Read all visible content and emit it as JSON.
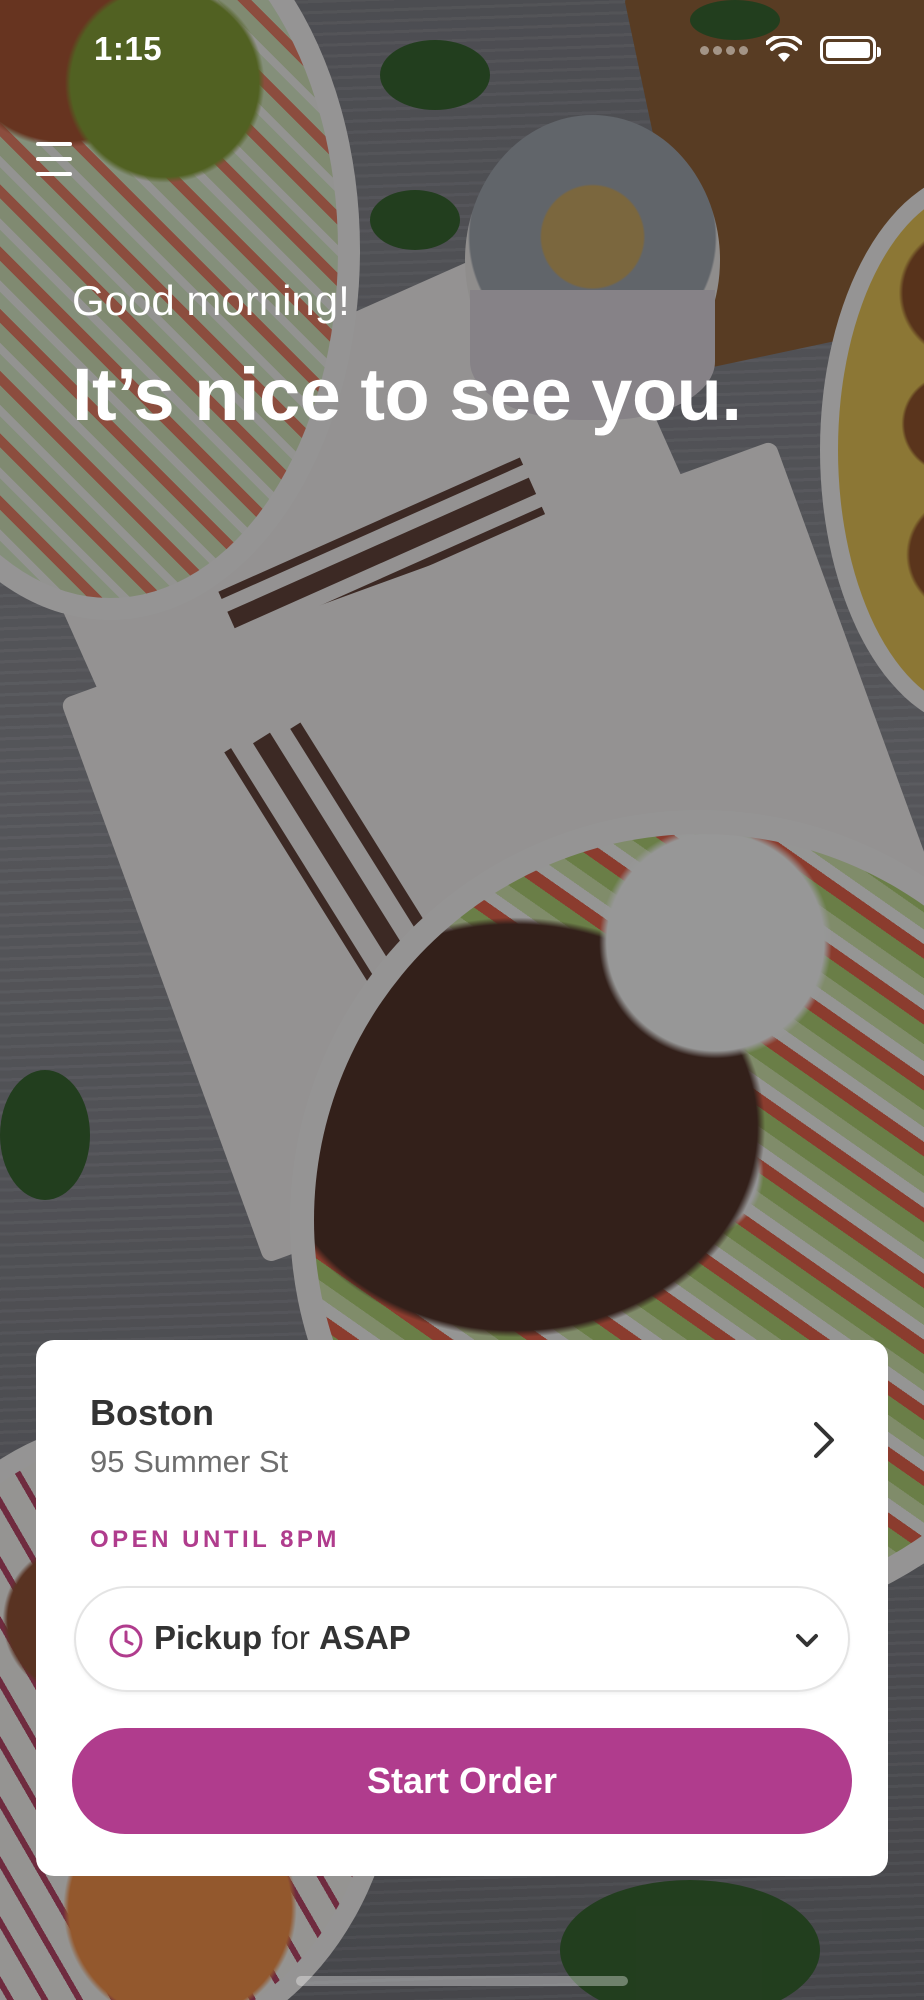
{
  "status_bar": {
    "time": "1:15"
  },
  "menu": {
    "icon": "hamburger-menu-icon"
  },
  "hero": {
    "greeting": "Good morning!",
    "headline": "It’s nice to see you."
  },
  "location": {
    "city": "Boston",
    "address": "95 Summer St",
    "hours": "OPEN UNTIL 8PM"
  },
  "order_mode": {
    "mode": "Pickup",
    "connector": "for",
    "time": "ASAP"
  },
  "actions": {
    "start_order": "Start Order"
  },
  "colors": {
    "accent": "#b03c8d",
    "card_background": "#ffffff",
    "text_primary": "#333333",
    "text_secondary": "#6e6e6e"
  },
  "icons": {
    "location_arrow": "chevron-right-icon",
    "mode_clock": "clock-icon",
    "mode_dropdown": "chevron-down-icon"
  }
}
